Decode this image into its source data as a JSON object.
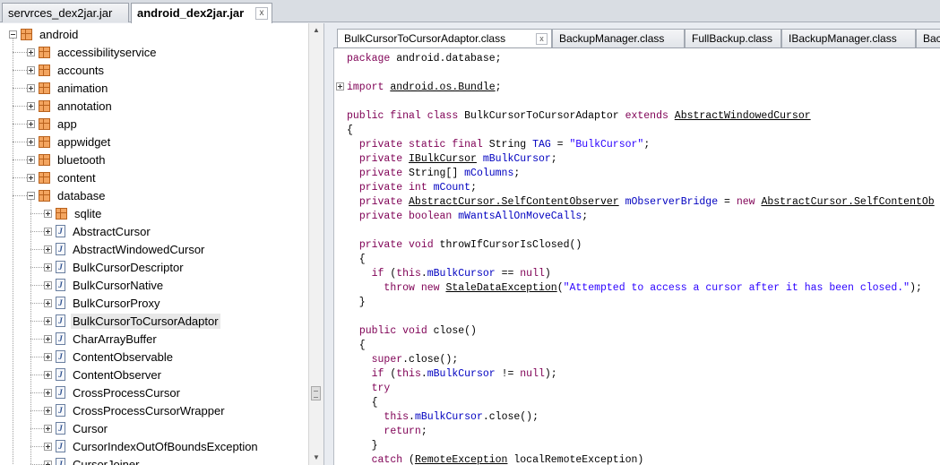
{
  "file_tabs": [
    {
      "label": "servrces_dex2jar.jar",
      "active": false
    },
    {
      "label": "android_dex2jar.jar",
      "active": true,
      "close": "x"
    }
  ],
  "tree": {
    "items": [
      {
        "label": "android",
        "icon": "package-icon",
        "expanded": true,
        "selected": false
      },
      {
        "label": "accessibilityservice",
        "icon": "package-icon",
        "expanded": false,
        "selected": false
      },
      {
        "label": "accounts",
        "icon": "package-icon",
        "expanded": false,
        "selected": false
      },
      {
        "label": "animation",
        "icon": "package-icon",
        "expanded": false,
        "selected": false
      },
      {
        "label": "annotation",
        "icon": "package-icon",
        "expanded": false,
        "selected": false
      },
      {
        "label": "app",
        "icon": "package-icon",
        "expanded": false,
        "selected": false
      },
      {
        "label": "appwidget",
        "icon": "package-icon",
        "expanded": false,
        "selected": false
      },
      {
        "label": "bluetooth",
        "icon": "package-icon",
        "expanded": false,
        "selected": false
      },
      {
        "label": "content",
        "icon": "package-icon",
        "expanded": false,
        "selected": false
      },
      {
        "label": "database",
        "icon": "package-icon",
        "expanded": true,
        "selected": false
      },
      {
        "label": "sqlite",
        "icon": "package-icon",
        "expanded": false,
        "selected": false
      },
      {
        "label": "AbstractCursor",
        "icon": "class-file-icon",
        "expanded": false,
        "selected": false
      },
      {
        "label": "AbstractWindowedCursor",
        "icon": "class-file-icon",
        "expanded": false,
        "selected": false
      },
      {
        "label": "BulkCursorDescriptor",
        "icon": "class-file-icon",
        "expanded": false,
        "selected": false
      },
      {
        "label": "BulkCursorNative",
        "icon": "class-file-icon",
        "expanded": false,
        "selected": false
      },
      {
        "label": "BulkCursorProxy",
        "icon": "class-file-icon",
        "expanded": false,
        "selected": false
      },
      {
        "label": "BulkCursorToCursorAdaptor",
        "icon": "class-file-icon",
        "expanded": false,
        "selected": true
      },
      {
        "label": "CharArrayBuffer",
        "icon": "class-file-icon",
        "expanded": false,
        "selected": false
      },
      {
        "label": "ContentObservable",
        "icon": "class-file-icon",
        "expanded": false,
        "selected": false
      },
      {
        "label": "ContentObserver",
        "icon": "class-file-icon",
        "expanded": false,
        "selected": false
      },
      {
        "label": "CrossProcessCursor",
        "icon": "class-file-icon",
        "expanded": false,
        "selected": false
      },
      {
        "label": "CrossProcessCursorWrapper",
        "icon": "class-file-icon",
        "expanded": false,
        "selected": false
      },
      {
        "label": "Cursor",
        "icon": "class-file-icon",
        "expanded": false,
        "selected": false
      },
      {
        "label": "CursorIndexOutOfBoundsException",
        "icon": "class-file-icon",
        "expanded": false,
        "selected": false
      },
      {
        "label": "CursorJoiner",
        "icon": "class-file-icon",
        "expanded": false,
        "selected": false
      }
    ]
  },
  "code_tabs": [
    {
      "label": "BulkCursorToCursorAdaptor.class",
      "active": true,
      "close": "x"
    },
    {
      "label": "BackupManager.class",
      "active": false
    },
    {
      "label": "FullBackup.class",
      "active": false
    },
    {
      "label": "IBackupManager.class",
      "active": false
    },
    {
      "label": "Bac",
      "active": false
    }
  ],
  "code": {
    "lines": [
      [
        {
          "t": "package",
          "c": "kw"
        },
        {
          "t": " android.database;"
        }
      ],
      [],
      [
        {
          "t": "import",
          "c": "kw"
        },
        {
          "t": " "
        },
        {
          "t": "android.os.Bundle",
          "c": "ln"
        },
        {
          "t": ";"
        }
      ],
      [],
      [
        {
          "t": "public final class",
          "c": "kw"
        },
        {
          "t": " BulkCursorToCursorAdaptor "
        },
        {
          "t": "extends",
          "c": "kw"
        },
        {
          "t": " "
        },
        {
          "t": "AbstractWindowedCursor",
          "c": "ln"
        }
      ],
      [
        {
          "t": "{"
        }
      ],
      [
        {
          "t": "  "
        },
        {
          "t": "private static final",
          "c": "kw"
        },
        {
          "t": " String "
        },
        {
          "t": "TAG",
          "c": "fd"
        },
        {
          "t": " = "
        },
        {
          "t": "\"BulkCursor\"",
          "c": "st"
        },
        {
          "t": ";"
        }
      ],
      [
        {
          "t": "  "
        },
        {
          "t": "private",
          "c": "kw"
        },
        {
          "t": " "
        },
        {
          "t": "IBulkCursor",
          "c": "ln"
        },
        {
          "t": " "
        },
        {
          "t": "mBulkCursor",
          "c": "fd"
        },
        {
          "t": ";"
        }
      ],
      [
        {
          "t": "  "
        },
        {
          "t": "private",
          "c": "kw"
        },
        {
          "t": " String[] "
        },
        {
          "t": "mColumns",
          "c": "fd"
        },
        {
          "t": ";"
        }
      ],
      [
        {
          "t": "  "
        },
        {
          "t": "private int",
          "c": "kw"
        },
        {
          "t": " "
        },
        {
          "t": "mCount",
          "c": "fd"
        },
        {
          "t": ";"
        }
      ],
      [
        {
          "t": "  "
        },
        {
          "t": "private",
          "c": "kw"
        },
        {
          "t": " "
        },
        {
          "t": "AbstractCursor.SelfContentObserver",
          "c": "ln"
        },
        {
          "t": " "
        },
        {
          "t": "mObserverBridge",
          "c": "fd"
        },
        {
          "t": " = "
        },
        {
          "t": "new",
          "c": "kw"
        },
        {
          "t": " "
        },
        {
          "t": "AbstractCursor.SelfContentOb",
          "c": "ln"
        }
      ],
      [
        {
          "t": "  "
        },
        {
          "t": "private boolean",
          "c": "kw"
        },
        {
          "t": " "
        },
        {
          "t": "mWantsAllOnMoveCalls",
          "c": "fd"
        },
        {
          "t": ";"
        }
      ],
      [],
      [
        {
          "t": "  "
        },
        {
          "t": "private void",
          "c": "kw"
        },
        {
          "t": " throwIfCursorIsClosed()"
        }
      ],
      [
        {
          "t": "  {"
        }
      ],
      [
        {
          "t": "    "
        },
        {
          "t": "if",
          "c": "kw"
        },
        {
          "t": " ("
        },
        {
          "t": "this",
          "c": "kw"
        },
        {
          "t": "."
        },
        {
          "t": "mBulkCursor",
          "c": "fd"
        },
        {
          "t": " == "
        },
        {
          "t": "null",
          "c": "kw"
        },
        {
          "t": ")"
        }
      ],
      [
        {
          "t": "      "
        },
        {
          "t": "throw new",
          "c": "kw"
        },
        {
          "t": " "
        },
        {
          "t": "StaleDataException",
          "c": "ln"
        },
        {
          "t": "("
        },
        {
          "t": "\"Attempted to access a cursor after it has been closed.\"",
          "c": "st"
        },
        {
          "t": ");"
        }
      ],
      [
        {
          "t": "  }"
        }
      ],
      [],
      [
        {
          "t": "  "
        },
        {
          "t": "public void",
          "c": "kw"
        },
        {
          "t": " close()"
        }
      ],
      [
        {
          "t": "  {"
        }
      ],
      [
        {
          "t": "    "
        },
        {
          "t": "super",
          "c": "kw"
        },
        {
          "t": ".close();"
        }
      ],
      [
        {
          "t": "    "
        },
        {
          "t": "if",
          "c": "kw"
        },
        {
          "t": " ("
        },
        {
          "t": "this",
          "c": "kw"
        },
        {
          "t": "."
        },
        {
          "t": "mBulkCursor",
          "c": "fd"
        },
        {
          "t": " != "
        },
        {
          "t": "null",
          "c": "kw"
        },
        {
          "t": ");"
        }
      ],
      [
        {
          "t": "    "
        },
        {
          "t": "try",
          "c": "kw"
        }
      ],
      [
        {
          "t": "    {"
        }
      ],
      [
        {
          "t": "      "
        },
        {
          "t": "this",
          "c": "kw"
        },
        {
          "t": "."
        },
        {
          "t": "mBulkCursor",
          "c": "fd"
        },
        {
          "t": ".close();"
        }
      ],
      [
        {
          "t": "      "
        },
        {
          "t": "return",
          "c": "kw"
        },
        {
          "t": ";"
        }
      ],
      [
        {
          "t": "    }"
        }
      ],
      [
        {
          "t": "    "
        },
        {
          "t": "catch",
          "c": "kw"
        },
        {
          "t": " ("
        },
        {
          "t": "RemoteException",
          "c": "ln"
        },
        {
          "t": " localRemoteException)"
        }
      ]
    ]
  },
  "colors": {
    "keyword": "#7f0055",
    "string": "#2a00ff",
    "field": "#0000c0",
    "package_icon": "#f3a560",
    "selection": "#e8e8e8"
  }
}
